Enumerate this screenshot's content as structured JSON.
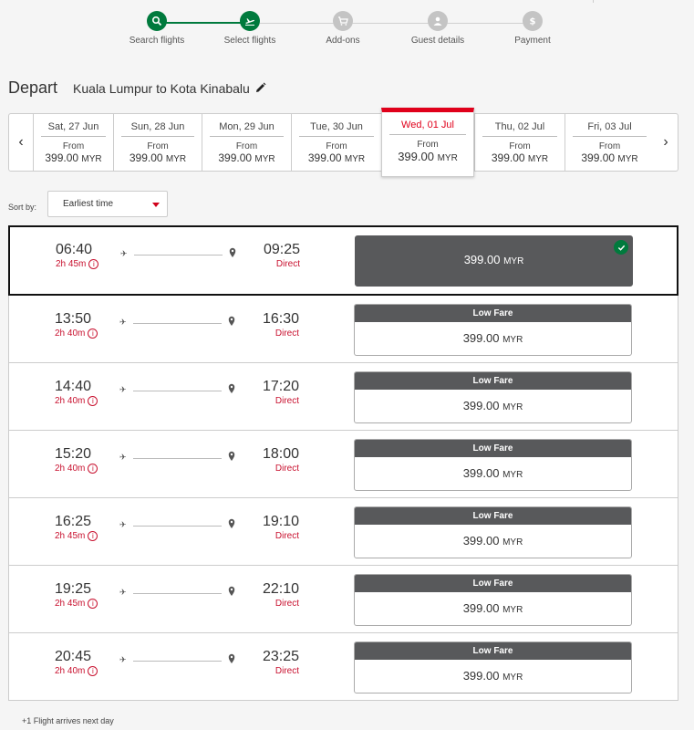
{
  "stepper": {
    "steps": [
      {
        "label": "Search flights",
        "state": "done"
      },
      {
        "label": "Select flights",
        "state": "current"
      },
      {
        "label": "Add-ons",
        "state": "pending"
      },
      {
        "label": "Guest details",
        "state": "pending"
      },
      {
        "label": "Payment",
        "state": "pending"
      }
    ],
    "active_color": "#007a3d",
    "pending_color": "#c4c4c4"
  },
  "header": {
    "title": "Depart",
    "route": "Kuala Lumpur to Kota Kinabalu"
  },
  "dates": {
    "from_label": "From",
    "currency": "MYR",
    "items": [
      {
        "label": "Sat, 27 Jun",
        "price": "399.00"
      },
      {
        "label": "Sun, 28 Jun",
        "price": "399.00"
      },
      {
        "label": "Mon, 29 Jun",
        "price": "399.00"
      },
      {
        "label": "Tue, 30 Jun",
        "price": "399.00"
      },
      {
        "label": "Wed, 01 Jul",
        "price": "399.00",
        "selected": true
      },
      {
        "label": "Thu, 02 Jul",
        "price": "399.00"
      },
      {
        "label": "Fri, 03 Jul",
        "price": "399.00"
      }
    ]
  },
  "sort": {
    "label": "Sort by:",
    "value": "Earliest time"
  },
  "flights": [
    {
      "dep": "06:40",
      "arr": "09:25",
      "duration": "2h 45m",
      "stops": "Direct",
      "fare_label": "",
      "price": "399.00",
      "currency": "MYR",
      "selected": true
    },
    {
      "dep": "13:50",
      "arr": "16:30",
      "duration": "2h 40m",
      "stops": "Direct",
      "fare_label": "Low Fare",
      "price": "399.00",
      "currency": "MYR"
    },
    {
      "dep": "14:40",
      "arr": "17:20",
      "duration": "2h 40m",
      "stops": "Direct",
      "fare_label": "Low Fare",
      "price": "399.00",
      "currency": "MYR"
    },
    {
      "dep": "15:20",
      "arr": "18:00",
      "duration": "2h 40m",
      "stops": "Direct",
      "fare_label": "Low Fare",
      "price": "399.00",
      "currency": "MYR"
    },
    {
      "dep": "16:25",
      "arr": "19:10",
      "duration": "2h 45m",
      "stops": "Direct",
      "fare_label": "Low Fare",
      "price": "399.00",
      "currency": "MYR"
    },
    {
      "dep": "19:25",
      "arr": "22:10",
      "duration": "2h 45m",
      "stops": "Direct",
      "fare_label": "Low Fare",
      "price": "399.00",
      "currency": "MYR"
    },
    {
      "dep": "20:45",
      "arr": "23:25",
      "duration": "2h 40m",
      "stops": "Direct",
      "fare_label": "Low Fare",
      "price": "399.00",
      "currency": "MYR"
    }
  ],
  "footnote": "+1 Flight arrives next day",
  "colors": {
    "accent_red": "#e0001b",
    "fare_header": "#58595b",
    "success_green": "#007a3d"
  }
}
